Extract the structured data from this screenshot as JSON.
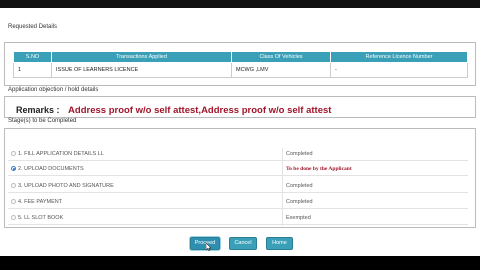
{
  "requested": {
    "title": "Requested Details",
    "columns": [
      "S.NO",
      "Transactions Applied",
      "Class Of Vehicles",
      "Reference Licence Number"
    ],
    "rows": [
      [
        "1",
        "ISSUE OF LEARNERS LICENCE",
        "MCWG ,LMV",
        "-"
      ]
    ]
  },
  "objection": {
    "title": "Application objection / hold details",
    "remarks_label": "Remarks :",
    "remarks_value": "Address proof w/o self attest,Address proof w/o self attest"
  },
  "stages": {
    "title": "Stage(s) to be Completed",
    "items": [
      {
        "label": "1.  FILL APPLICATION DETAILS LL",
        "status": "Completed",
        "selected": false
      },
      {
        "label": "2.  UPLOAD DOCUMENTS",
        "status": "To be done by the Applicant",
        "selected": true
      },
      {
        "label": "3.  UPLOAD PHOTO AND SIGNATURE",
        "status": "Completed",
        "selected": false
      },
      {
        "label": "4.  FEE PAYMENT",
        "status": "Completed",
        "selected": false
      },
      {
        "label": "5.  LL SLOT BOOK",
        "status": "Exempted",
        "selected": false
      }
    ]
  },
  "buttons": {
    "proceed": "Proceed",
    "cancel": "Cancel",
    "home": "Home"
  },
  "colors": {
    "header_teal": "#3aa0b8",
    "remarks_red": "#a0152a"
  }
}
